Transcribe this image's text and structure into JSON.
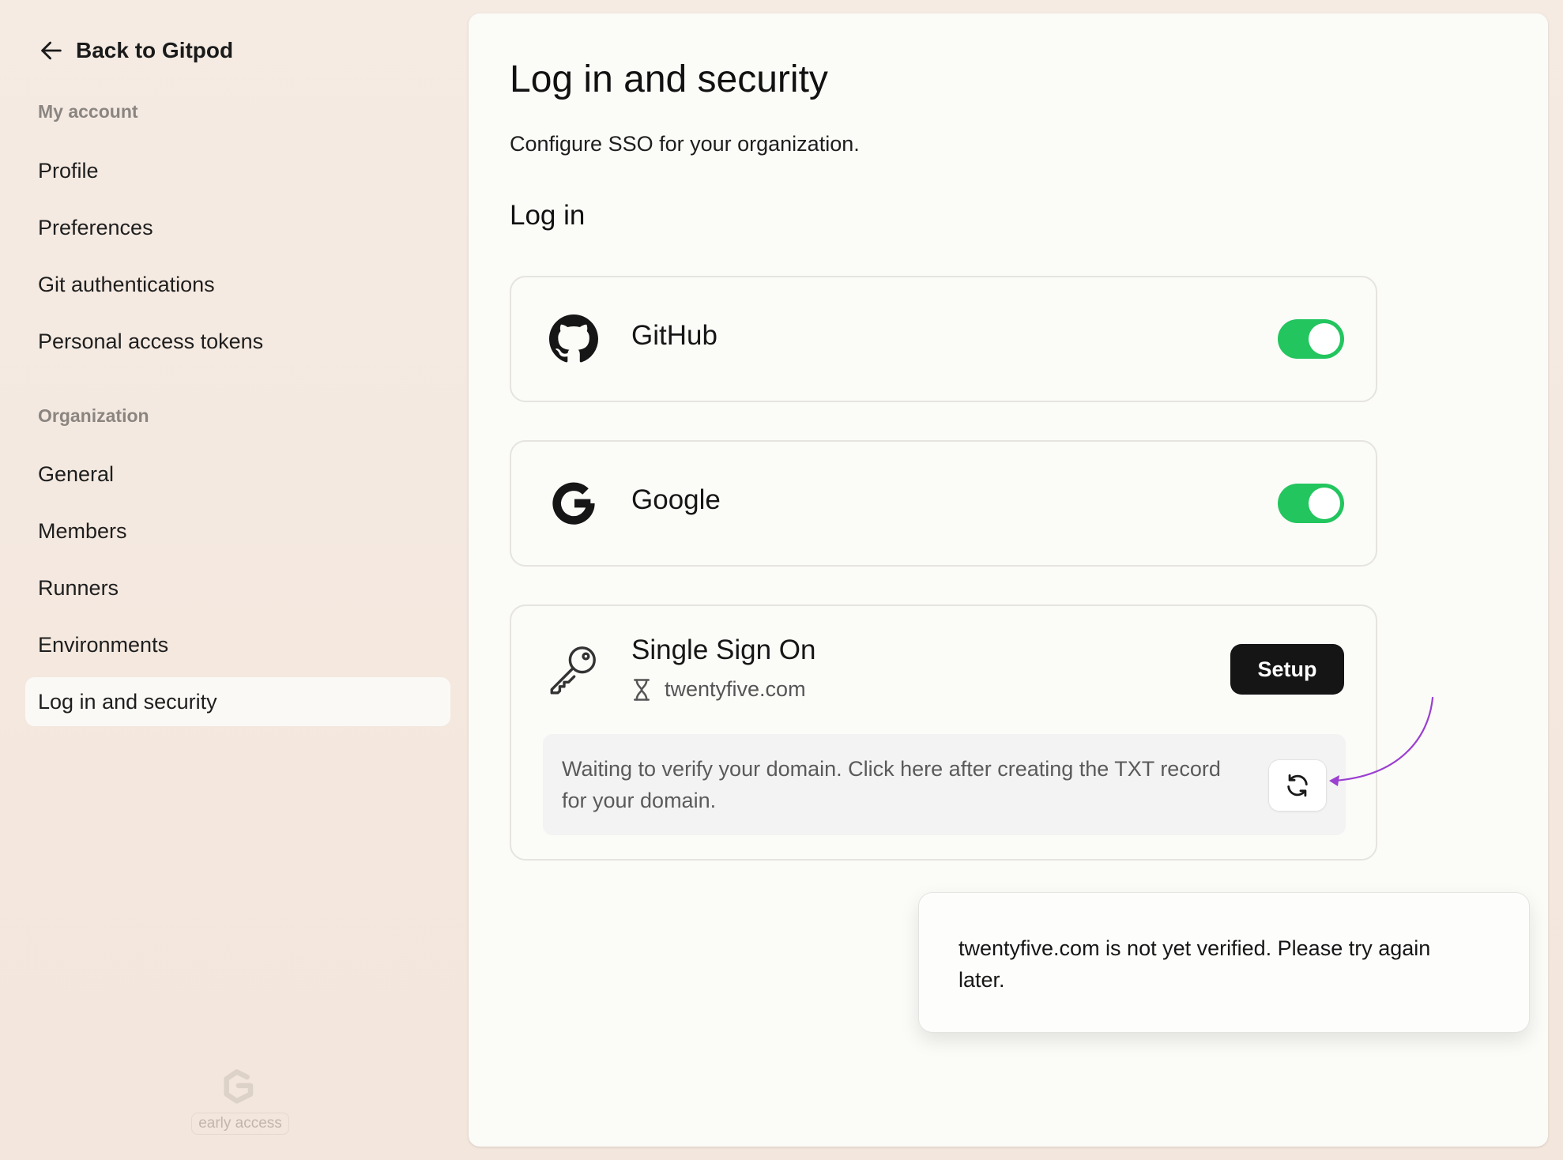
{
  "sidebar": {
    "back_label": "Back to Gitpod",
    "my_account_label": "My account",
    "my_account_items": [
      {
        "label": "Profile"
      },
      {
        "label": "Preferences"
      },
      {
        "label": "Git authentications"
      },
      {
        "label": "Personal access tokens"
      }
    ],
    "organization_label": "Organization",
    "organization_items": [
      {
        "label": "General"
      },
      {
        "label": "Members"
      },
      {
        "label": "Runners"
      },
      {
        "label": "Environments"
      },
      {
        "label": "Log in and security",
        "active": true
      }
    ],
    "badge": "early access"
  },
  "main": {
    "title": "Log in and security",
    "subtitle": "Configure SSO for your organization.",
    "section_title": "Log in",
    "providers": [
      {
        "name": "GitHub",
        "icon": "github-icon",
        "enabled": true
      },
      {
        "name": "Google",
        "icon": "google-icon",
        "enabled": true
      }
    ],
    "sso": {
      "title": "Single Sign On",
      "icon": "key-icon",
      "domain": "twentyfive.com",
      "status_icon": "hourglass-icon",
      "setup_label": "Setup",
      "info_text": "Waiting to verify your domain. Click here after creating the TXT record for your domain.",
      "refresh_icon": "refresh-icon"
    }
  },
  "toast": {
    "message": "twentyfive.com is not yet verified. Please try again later."
  },
  "colors": {
    "toggle_on": "#22c55e",
    "button_dark": "#151515",
    "annotation_arrow": "#9b3fd0"
  }
}
